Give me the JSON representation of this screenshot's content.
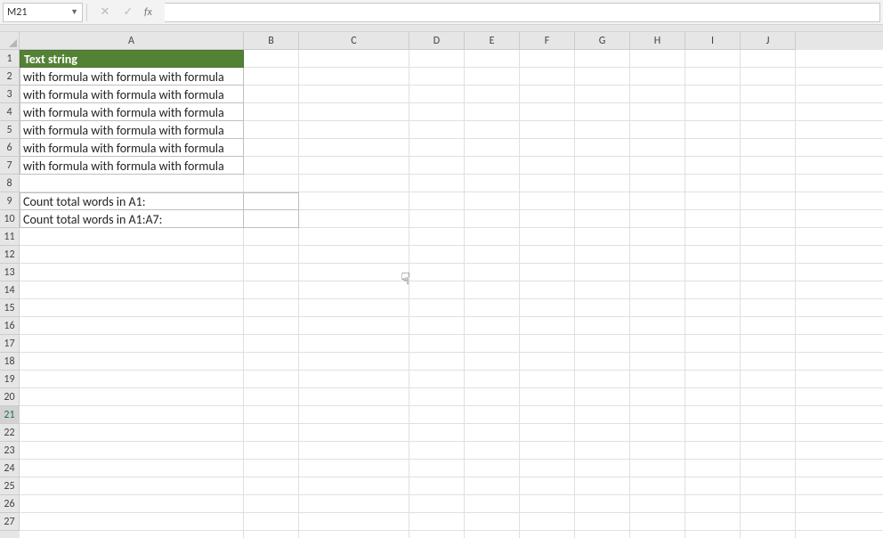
{
  "formula_bar": {
    "name_box": "M21",
    "cancel_icon": "✕",
    "accept_icon": "✓",
    "fx_label": "fx",
    "formula_value": ""
  },
  "columns": [
    "A",
    "B",
    "C",
    "D",
    "E",
    "F",
    "G",
    "H",
    "I",
    "J"
  ],
  "col_widths": {
    "A": 252,
    "B": 62,
    "C": 124,
    "D": 62,
    "E": 62,
    "F": 62,
    "G": 62,
    "H": 62,
    "I": 62,
    "J": 62
  },
  "rows": 27,
  "active_cell": {
    "ref": "M21",
    "row": 21,
    "col": "M"
  },
  "cells": {
    "A1": {
      "value": "Text string",
      "header": true
    },
    "A2": {
      "value": "with formula with formula with formula"
    },
    "A3": {
      "value": "with formula with formula with formula"
    },
    "A4": {
      "value": "with formula with formula with formula"
    },
    "A5": {
      "value": "with formula with formula with formula"
    },
    "A6": {
      "value": "with formula with formula with formula"
    },
    "A7": {
      "value": "with formula with formula with formula"
    },
    "A9": {
      "value": "Count total words in A1:"
    },
    "A10": {
      "value": "Count total words in A1:A7:"
    },
    "B9": {
      "value": ""
    },
    "B10": {
      "value": ""
    }
  },
  "cursor_glyph": "☟"
}
